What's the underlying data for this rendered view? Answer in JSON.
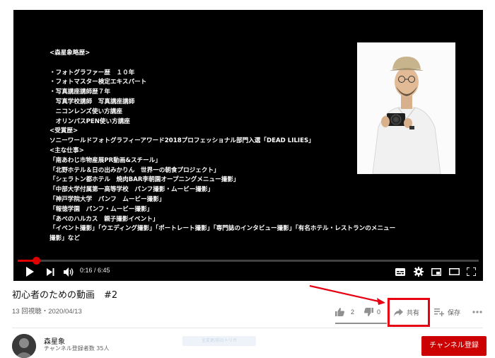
{
  "player": {
    "slide_lines": [
      "<森星象略歴>",
      "",
      "・フォトグラファー歴　１０年",
      "・フォトマスター検定エキスパート",
      "・写真講座講師歴７年",
      "　写真学校講師　写真講座講師",
      "　ニコンレンズ使い方講座",
      "　オリンパスPEN使い方講座",
      "<受賞歴>",
      "ソニーワールドフォトグラフィーアワード2018プロフェッショナル部門入選「DEAD LILIES」",
      "<主な仕事>",
      "「南あわじ市物産展PR動画&スチール」",
      "「北野ホテル＆日の出みかりん　世界一の朝食プロジェクト」",
      "「シェラトン都ホテル　焼肉BAR李朝園オープニングメニュー撮影」",
      "「中部大学付属第一高等学校　パンフ撮影・ムービー撮影」",
      "「神戸学院大学　パンフ　ムービー撮影」",
      "「報徳学園　パンフ・ムービー撮影」",
      "「あべのハルカス　親子撮影イベント」",
      "「イベント撮影」「ウエディング撮影」「ポートレート撮影」「専門誌のインタビュー撮影」「有名ホテル・レストランのメニュー",
      "撮影」など"
    ],
    "time_display": "0:16 / 6:45",
    "progress_fraction": 0.04,
    "icons": [
      "play-icon",
      "next-icon",
      "volume-icon",
      "subtitles-icon",
      "settings-icon",
      "miniplayer-icon",
      "theater-icon",
      "fullscreen-icon"
    ]
  },
  "video": {
    "title": "初心者のための動画　#2",
    "meta": "13 回視聴・2020/04/13"
  },
  "actions": {
    "like_count": "2",
    "dislike_count": "0",
    "share_label": "共有",
    "save_label": "保存"
  },
  "channel": {
    "name": "森星象",
    "subscribers": "チャンネル登録者数 35人",
    "subscribe_label": "チャンネル登録",
    "blurred_text": "全変更/前のトリガ"
  },
  "colors": {
    "accent_red": "#e00000",
    "highlight_red": "#e60012",
    "subscribe_red": "#cc0000"
  }
}
